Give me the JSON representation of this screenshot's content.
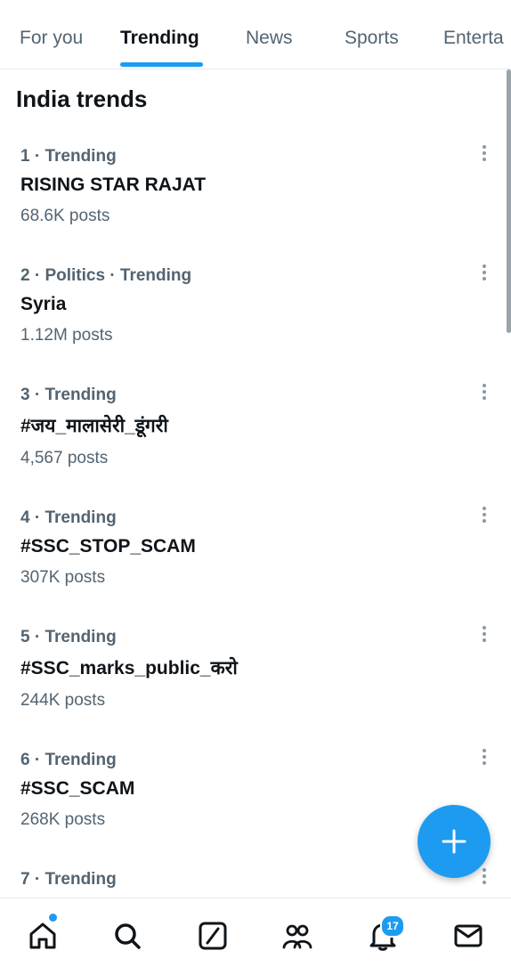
{
  "tabs": [
    {
      "label": "For you",
      "active": false
    },
    {
      "label": "Trending",
      "active": true
    },
    {
      "label": "News",
      "active": false
    },
    {
      "label": "Sports",
      "active": false
    },
    {
      "label": "Enterta",
      "active": false
    }
  ],
  "section_title": "India trends",
  "trends": [
    {
      "meta": "1 · Trending",
      "name": "RISING STAR RAJAT",
      "count": "68.6K posts"
    },
    {
      "meta": "2 · Politics · Trending",
      "name": "Syria",
      "count": "1.12M posts"
    },
    {
      "meta": "3 · Trending",
      "name": "#जय_मालासेरी_डूंगरी",
      "count": "4,567 posts"
    },
    {
      "meta": "4 · Trending",
      "name": "#SSC_STOP_SCAM",
      "count": "307K posts"
    },
    {
      "meta": "5 · Trending",
      "name": "#SSC_marks_public_करो",
      "count": "244K posts"
    },
    {
      "meta": "6 · Trending",
      "name": "#SSC_SCAM",
      "count": "268K posts"
    },
    {
      "meta": "7 · Trending",
      "name": "",
      "count": ""
    }
  ],
  "fab": {
    "icon": "plus-icon"
  },
  "bottom_nav": [
    {
      "icon": "home-icon"
    },
    {
      "icon": "search-icon"
    },
    {
      "icon": "grok-icon"
    },
    {
      "icon": "communities-icon"
    },
    {
      "icon": "notifications-icon",
      "badge": "17"
    },
    {
      "icon": "messages-icon"
    }
  ],
  "colors": {
    "accent": "#1d9bf0",
    "text": "#0f1419",
    "secondary": "#536471"
  }
}
